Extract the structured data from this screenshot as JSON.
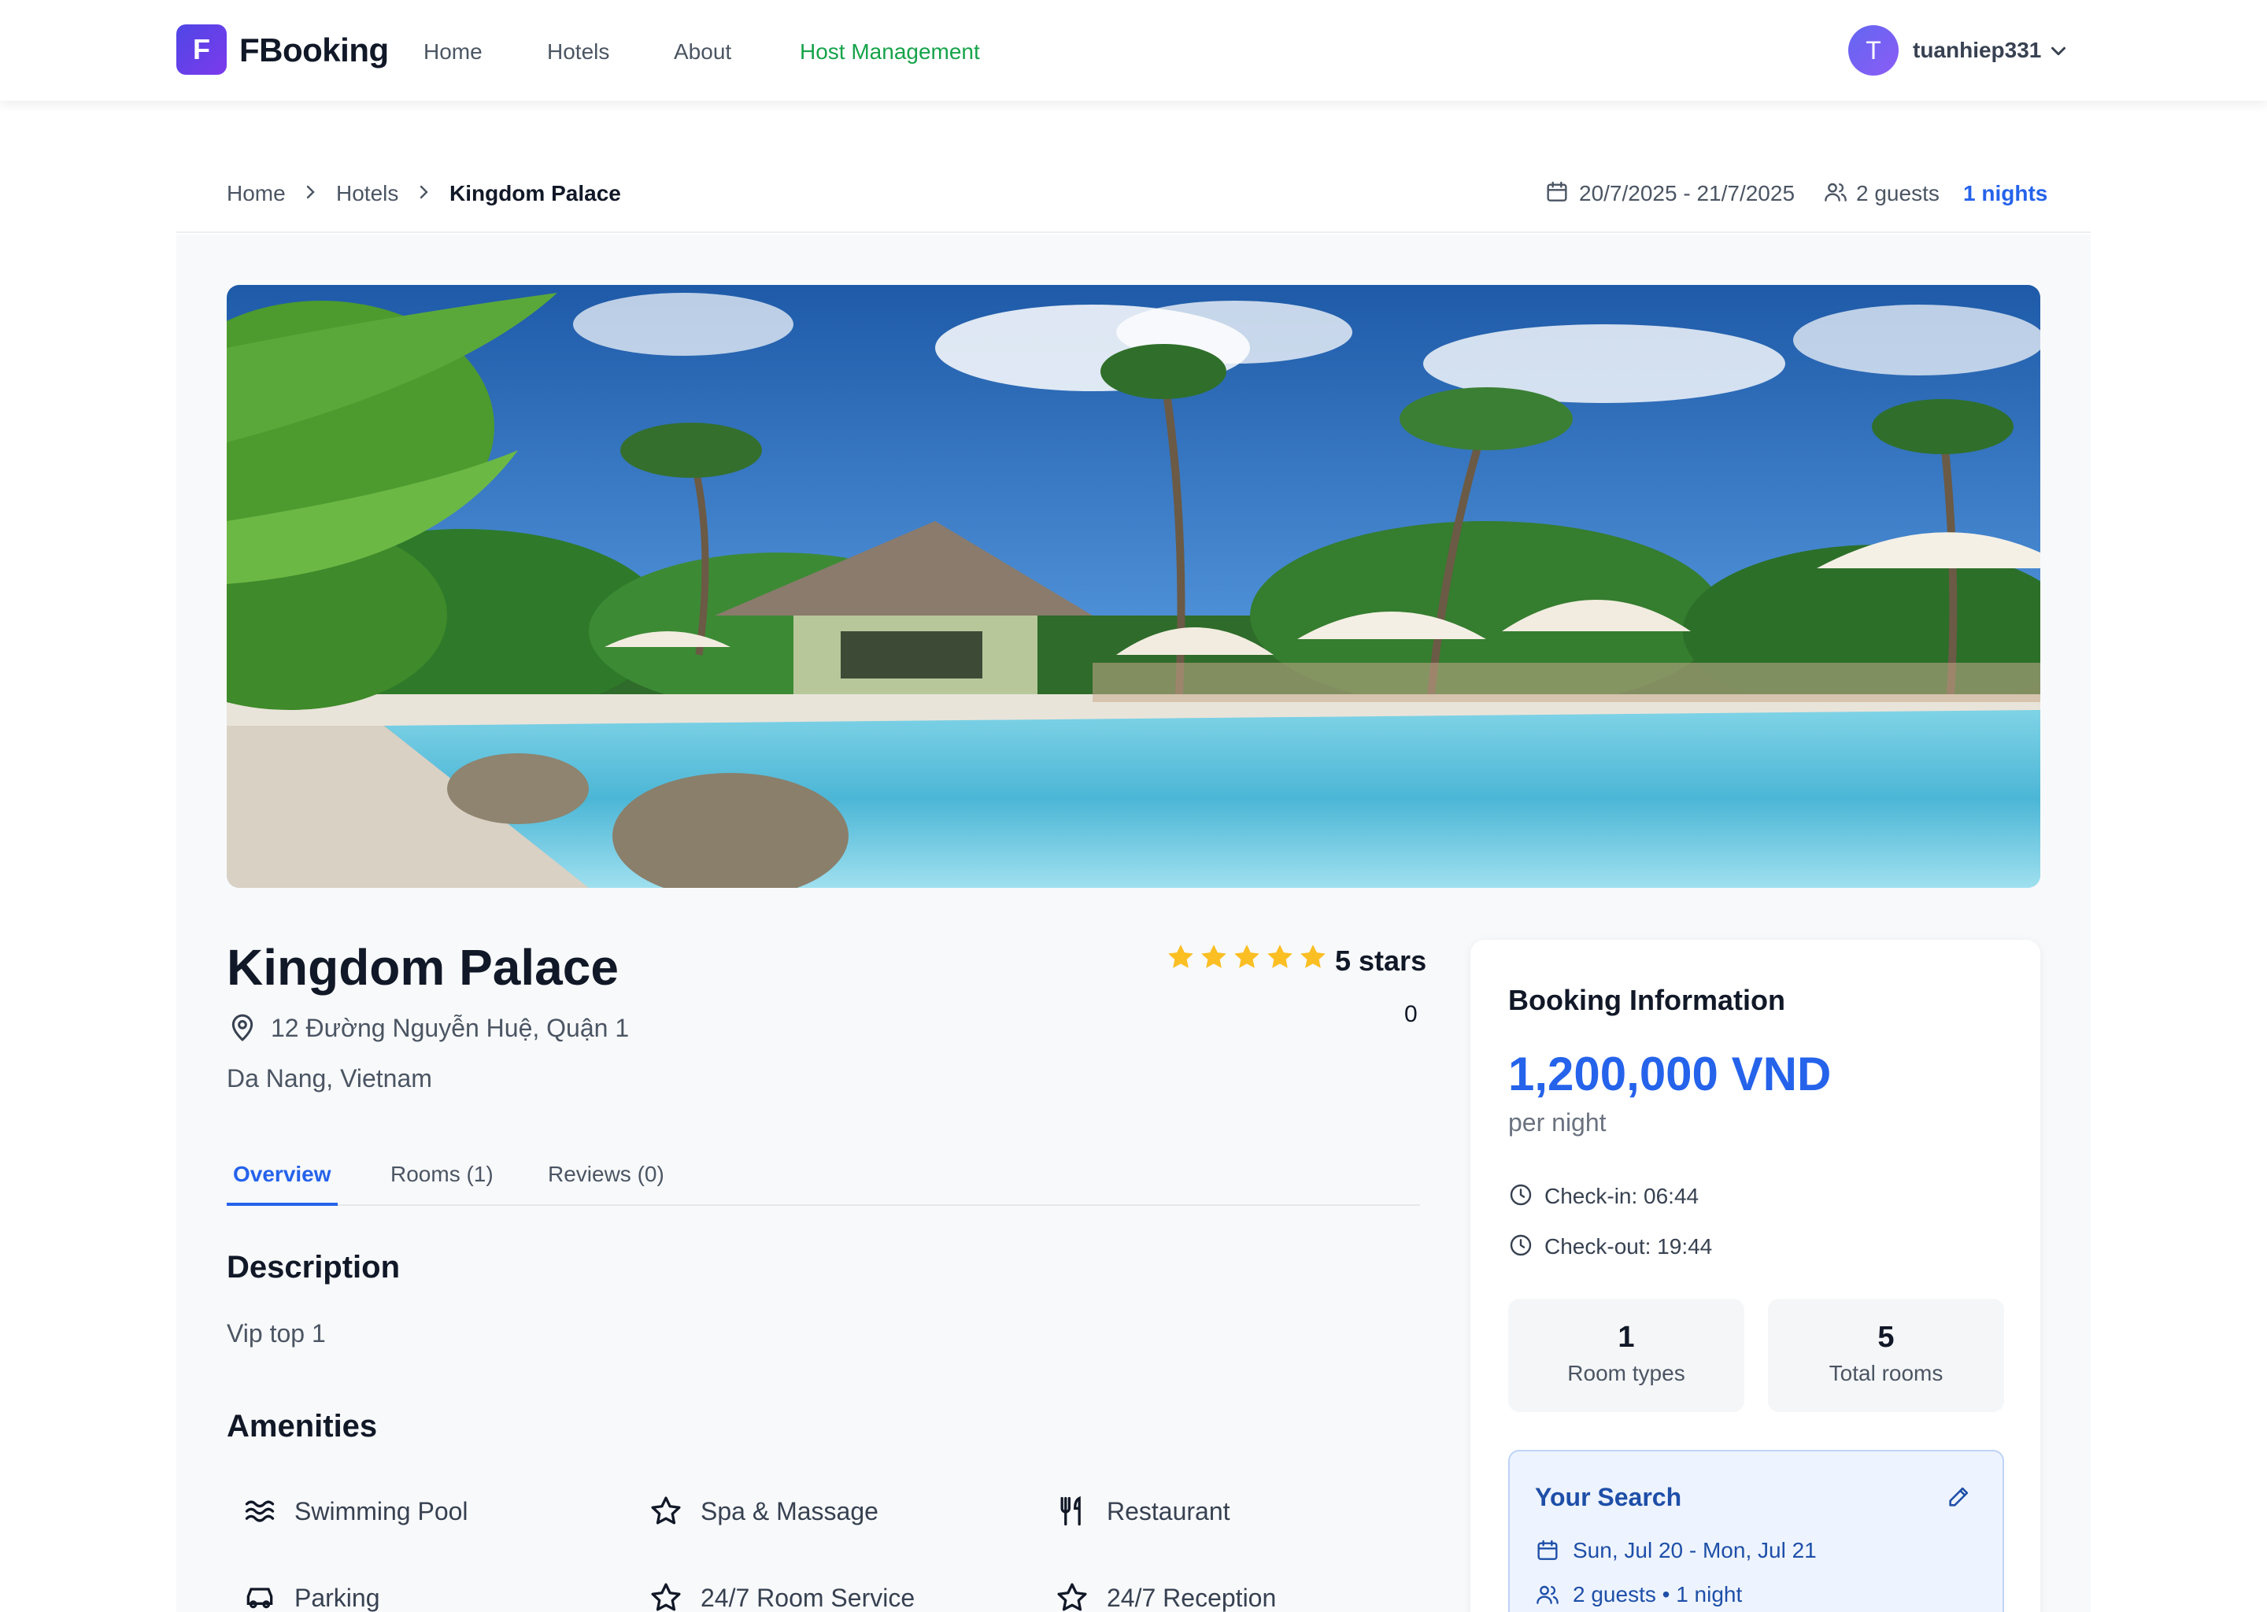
{
  "brand": {
    "logo_letter": "F",
    "name": "FBooking"
  },
  "nav": {
    "links": [
      {
        "label": "Home",
        "active": false
      },
      {
        "label": "Hotels",
        "active": false
      },
      {
        "label": "About",
        "active": false
      },
      {
        "label": "Host Management",
        "active": true
      }
    ],
    "active_color": "#16a34a"
  },
  "user": {
    "initial": "T",
    "username": "tuanhiep331"
  },
  "breadcrumb": [
    "Home",
    "Hotels",
    "Kingdom Palace"
  ],
  "trip": {
    "dates": "20/7/2025 - 21/7/2025",
    "guests": "2 guests",
    "nights": "1 nights"
  },
  "hotel": {
    "name": "Kingdom Palace",
    "address": "12 Đường Nguyễn Huệ, Quận 1",
    "city": "Da Nang, Vietnam",
    "star_rating": 5,
    "stars_label": "5 stars",
    "review_count": "0"
  },
  "tabs": [
    {
      "label": "Overview",
      "active": true
    },
    {
      "label": "Rooms (1)",
      "active": false
    },
    {
      "label": "Reviews (0)",
      "active": false
    }
  ],
  "description": {
    "title": "Description",
    "text": "Vip top 1"
  },
  "amenities": {
    "title": "Amenities",
    "items": [
      {
        "label": "Swimming Pool",
        "icon": "waves-icon"
      },
      {
        "label": "Spa & Massage",
        "icon": "star-outline-icon"
      },
      {
        "label": "Restaurant",
        "icon": "utensils-icon"
      },
      {
        "label": "Parking",
        "icon": "car-icon"
      },
      {
        "label": "24/7 Room Service",
        "icon": "star-outline-icon"
      },
      {
        "label": "24/7 Reception",
        "icon": "star-outline-icon"
      }
    ]
  },
  "booking": {
    "title": "Booking Information",
    "price": "1,200,000 VND",
    "per": "per night",
    "checkin": "Check-in: 06:44",
    "checkout": "Check-out: 19:44",
    "stats": [
      {
        "value": "1",
        "label": "Room types"
      },
      {
        "value": "5",
        "label": "Total rooms"
      }
    ],
    "search": {
      "title": "Your Search",
      "dates": "Sun, Jul 20 - Mon, Jul 21",
      "guests": "2 guests • 1 night"
    }
  },
  "colors": {
    "primary": "#2563eb",
    "star": "#fbbf24",
    "brand_gradient_start": "#4f46e5",
    "brand_gradient_end": "#7c3aed"
  }
}
